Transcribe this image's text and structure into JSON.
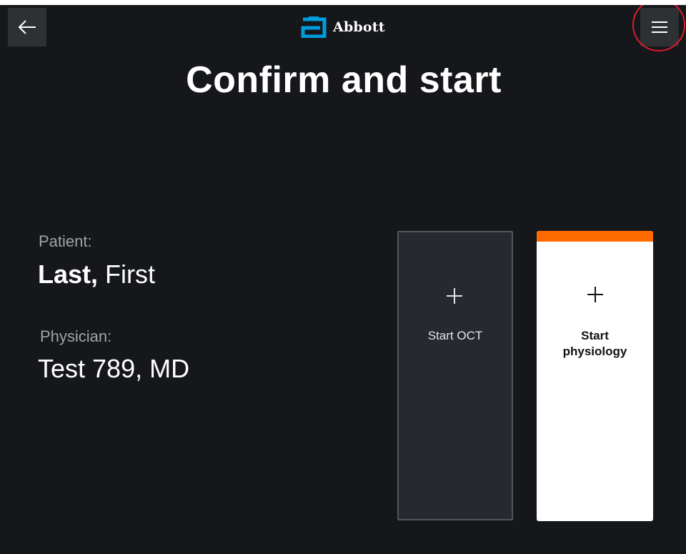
{
  "header": {
    "back_icon": "arrow-left-icon",
    "logo_icon": "abbott-logo-mark",
    "brand": "Abbott",
    "menu_icon": "hamburger-menu-icon",
    "brand_color": "#009cde"
  },
  "page": {
    "title": "Confirm and start"
  },
  "patient": {
    "label": "Patient:",
    "last": "Last,",
    "first": " First"
  },
  "physician": {
    "label": "Physician:",
    "value": "Test 789, MD"
  },
  "cards": {
    "oct": {
      "icon": "plus-icon",
      "label": "Start OCT"
    },
    "physiology": {
      "icon": "plus-icon",
      "label": "Start physiology",
      "accent_color": "#ff6a00"
    }
  },
  "colors": {
    "background": "#15171b",
    "highlight_ring": "#e21b2c"
  }
}
